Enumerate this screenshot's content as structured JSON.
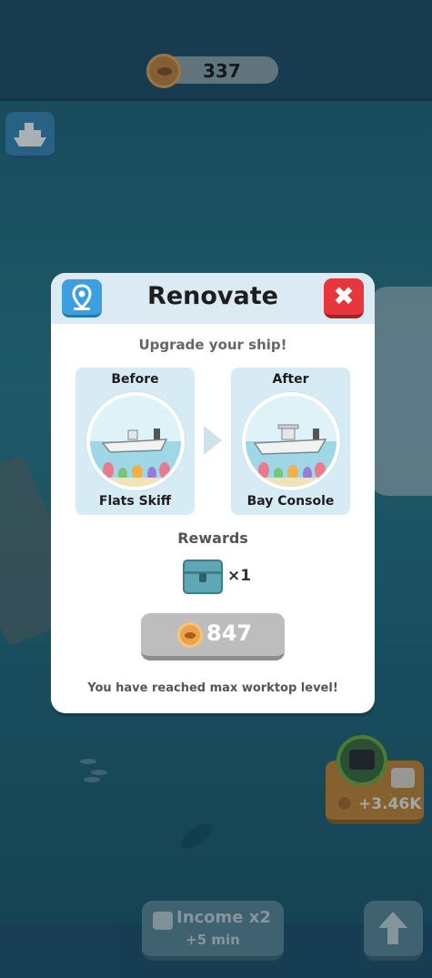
{
  "hud": {
    "coins": "337"
  },
  "modal": {
    "title": "Renovate",
    "subtitle": "Upgrade your ship!",
    "before": {
      "label": "Before",
      "ship_name": "Flats Skiff"
    },
    "after": {
      "label": "After",
      "ship_name": "Bay Console"
    },
    "rewards_label": "Rewards",
    "reward_count": "×1",
    "price": "847",
    "max_note": "You have reached max worktop level!"
  },
  "side_reward": {
    "amount": "+3.46K"
  },
  "bottom": {
    "income_label": "Income x2",
    "income_time": "+5 min"
  },
  "colors": {
    "close": "#e5373c",
    "location": "#3b9fe0",
    "buy_disabled": "#bdbdbd",
    "header": "#dbeaf3"
  },
  "icons": [
    "coin-icon",
    "ship-icon",
    "location-pin-icon",
    "close-icon",
    "chest-icon",
    "video-icon",
    "up-arrow-icon"
  ]
}
